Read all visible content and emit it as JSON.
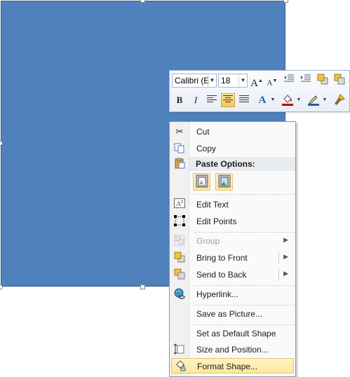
{
  "mini_toolbar": {
    "font_name": "Calibri (E",
    "font_size": "18",
    "font_grow_icon": "A",
    "font_shrink_icon": "A",
    "bold": "B",
    "italic": "I",
    "font_color_glyph": "A"
  },
  "context_menu": {
    "cut": "Cut",
    "copy": "Copy",
    "paste_options": "Paste Options:",
    "edit_text": "Edit Text",
    "edit_points": "Edit Points",
    "group": "Group",
    "bring_to_front": "Bring to Front",
    "send_to_back": "Send to Back",
    "hyperlink": "Hyperlink...",
    "save_as_picture": "Save as Picture...",
    "set_default_shape": "Set as Default Shape",
    "size_and_position": "Size and Position...",
    "format_shape": "Format Shape..."
  },
  "colors": {
    "shape_fill": "#4f81bd",
    "highlight": "#fde79d",
    "font_color_bar": "#c00000",
    "fill_color_bar": "#ffff00"
  }
}
